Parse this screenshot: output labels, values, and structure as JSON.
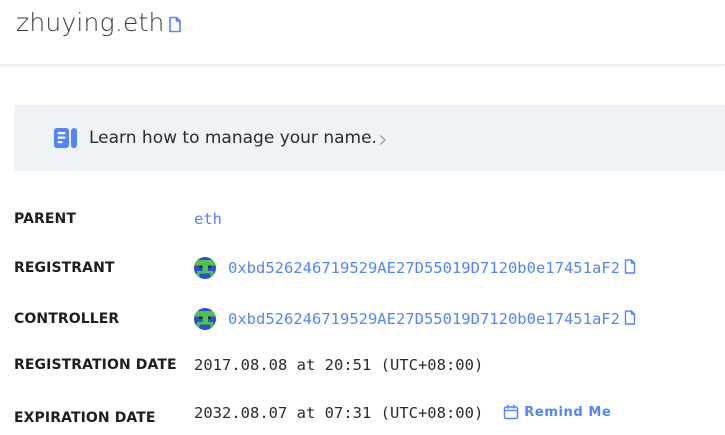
{
  "header": {
    "name": "zhuying.eth"
  },
  "banner": {
    "text": "Learn how to manage your name."
  },
  "details": {
    "parent": {
      "label": "PARENT",
      "value": "eth"
    },
    "registrant": {
      "label": "REGISTRANT",
      "address": "0xbd526246719529AE27D55019D7120b0e17451aF2"
    },
    "controller": {
      "label": "CONTROLLER",
      "address": "0xbd526246719529AE27D55019D7120b0e17451aF2"
    },
    "registration_date": {
      "label": "REGISTRATION DATE",
      "value": "2017.08.08 at 20:51 (UTC+08:00)"
    },
    "expiration_date": {
      "label": "EXPIRATION DATE",
      "value": "2032.08.07 at 07:31 (UTC+08:00)",
      "remind_label": "Remind Me"
    }
  },
  "icons": {
    "copy": "copy-icon",
    "banner": "document-icon",
    "chevron": "chevron-right-icon",
    "calendar": "calendar-icon",
    "avatar": "identicon-avatar"
  },
  "colors": {
    "accent": "#5284ff",
    "banner_bg": "#eff3f7",
    "avatar_green": "#4ec44e",
    "avatar_blue": "#2a4ed4"
  }
}
